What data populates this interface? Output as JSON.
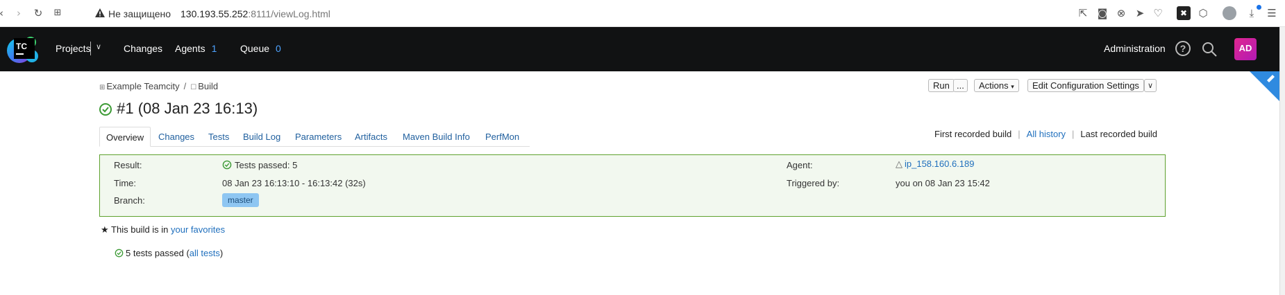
{
  "browser": {
    "insecure_label": "Не защищено",
    "url_host": "130.193.55.252",
    "url_rest": ":8111/viewLog.html"
  },
  "header": {
    "logo_text": "TC",
    "nav": {
      "projects": "Projects",
      "changes": "Changes",
      "agents": "Agents",
      "agents_count": "1",
      "queue": "Queue",
      "queue_count": "0"
    },
    "administration": "Administration",
    "user_initials": "AD"
  },
  "breadcrumb": {
    "project": "Example Teamcity",
    "separator": "/",
    "build_config": "Build"
  },
  "toolbar": {
    "run": "Run",
    "run_more": "...",
    "actions": "Actions",
    "edit_settings": "Edit Configuration Settings"
  },
  "build": {
    "title": "#1 (08 Jan 23 16:13)"
  },
  "tabs": [
    "Overview",
    "Changes",
    "Tests",
    "Build Log",
    "Parameters",
    "Artifacts",
    "Maven Build Info",
    "PerfMon"
  ],
  "history": {
    "first": "First recorded build",
    "all": "All history",
    "last": "Last recorded build"
  },
  "summary": {
    "result_label": "Result:",
    "result_value": "Tests passed: 5",
    "time_label": "Time:",
    "time_value": "08 Jan 23 16:13:10 - 16:13:42 (32s)",
    "branch_label": "Branch:",
    "branch_value": "master",
    "agent_label": "Agent:",
    "agent_value": "ip_158.160.6.189",
    "triggered_label": "Triggered by:",
    "triggered_value": "you on 08 Jan 23 15:42"
  },
  "favorites": {
    "prefix": "This build is in ",
    "link": "your favorites"
  },
  "tests": {
    "prefix": "5 tests passed (",
    "link": "all tests",
    "suffix": ")"
  },
  "colors": {
    "header_bg": "#111213",
    "success_green": "#5ea12d",
    "link_blue": "#1f6fbd",
    "branch_badge": "#8ec6f2",
    "avatar_magenta": "#d1239b"
  }
}
